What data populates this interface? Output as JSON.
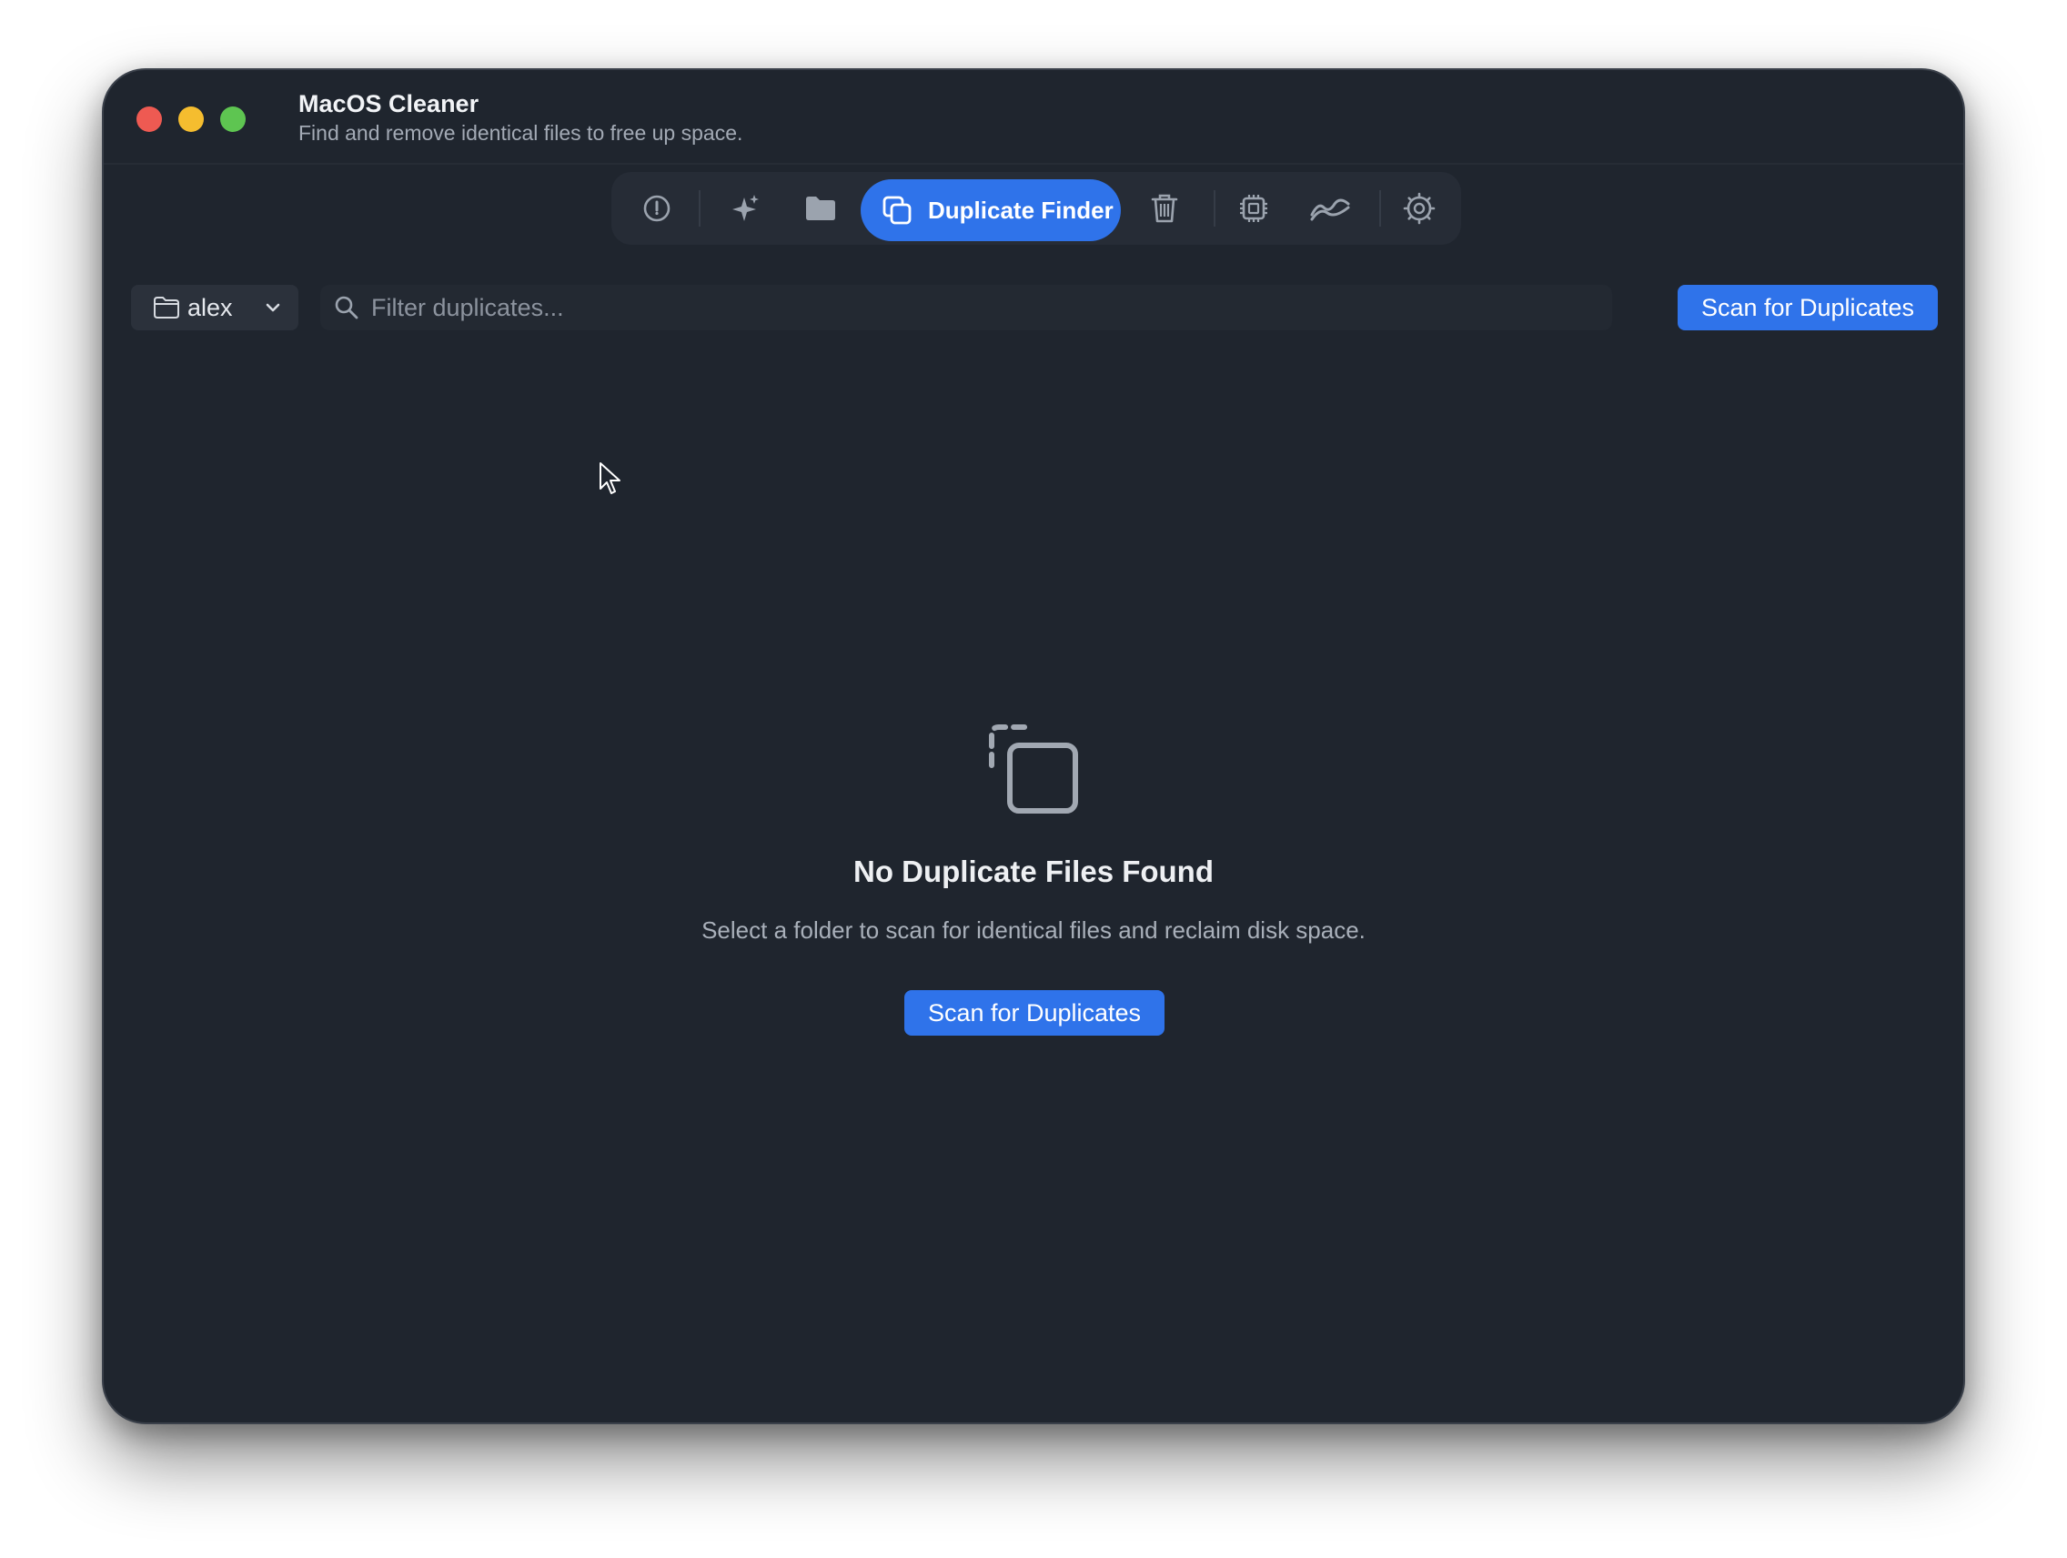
{
  "app": {
    "title": "MacOS Cleaner",
    "subtitle": "Find and remove identical files to free up space."
  },
  "toolbar": {
    "items": [
      {
        "name": "dashboard",
        "icon": "gauge-icon"
      },
      {
        "name": "smart-scan",
        "icon": "sparkles-icon"
      },
      {
        "name": "file-explorer",
        "icon": "folder-icon"
      },
      {
        "name": "duplicate-finder",
        "icon": "copy-icon",
        "label": "Duplicate Finder",
        "active": true
      },
      {
        "name": "trash",
        "icon": "trash-icon"
      },
      {
        "name": "cpu",
        "icon": "cpu-icon"
      },
      {
        "name": "activity",
        "icon": "activity-icon"
      },
      {
        "name": "settings",
        "icon": "gear-icon"
      }
    ],
    "active_label": "Duplicate Finder"
  },
  "filter_bar": {
    "folder": "alex",
    "search_placeholder": "Filter duplicates...",
    "scan_button": "Scan for Duplicates"
  },
  "empty_state": {
    "icon": "copy-icon",
    "title": "No Duplicate Files Found",
    "description": "Select a folder to scan for identical files and reclaim disk space.",
    "button": "Scan for Duplicates"
  },
  "colors": {
    "window_bg": "#1f252e",
    "accent": "#2f73ea",
    "traffic_close": "#ee5a52",
    "traffic_min": "#f5bd2f",
    "traffic_max": "#5ec551"
  }
}
